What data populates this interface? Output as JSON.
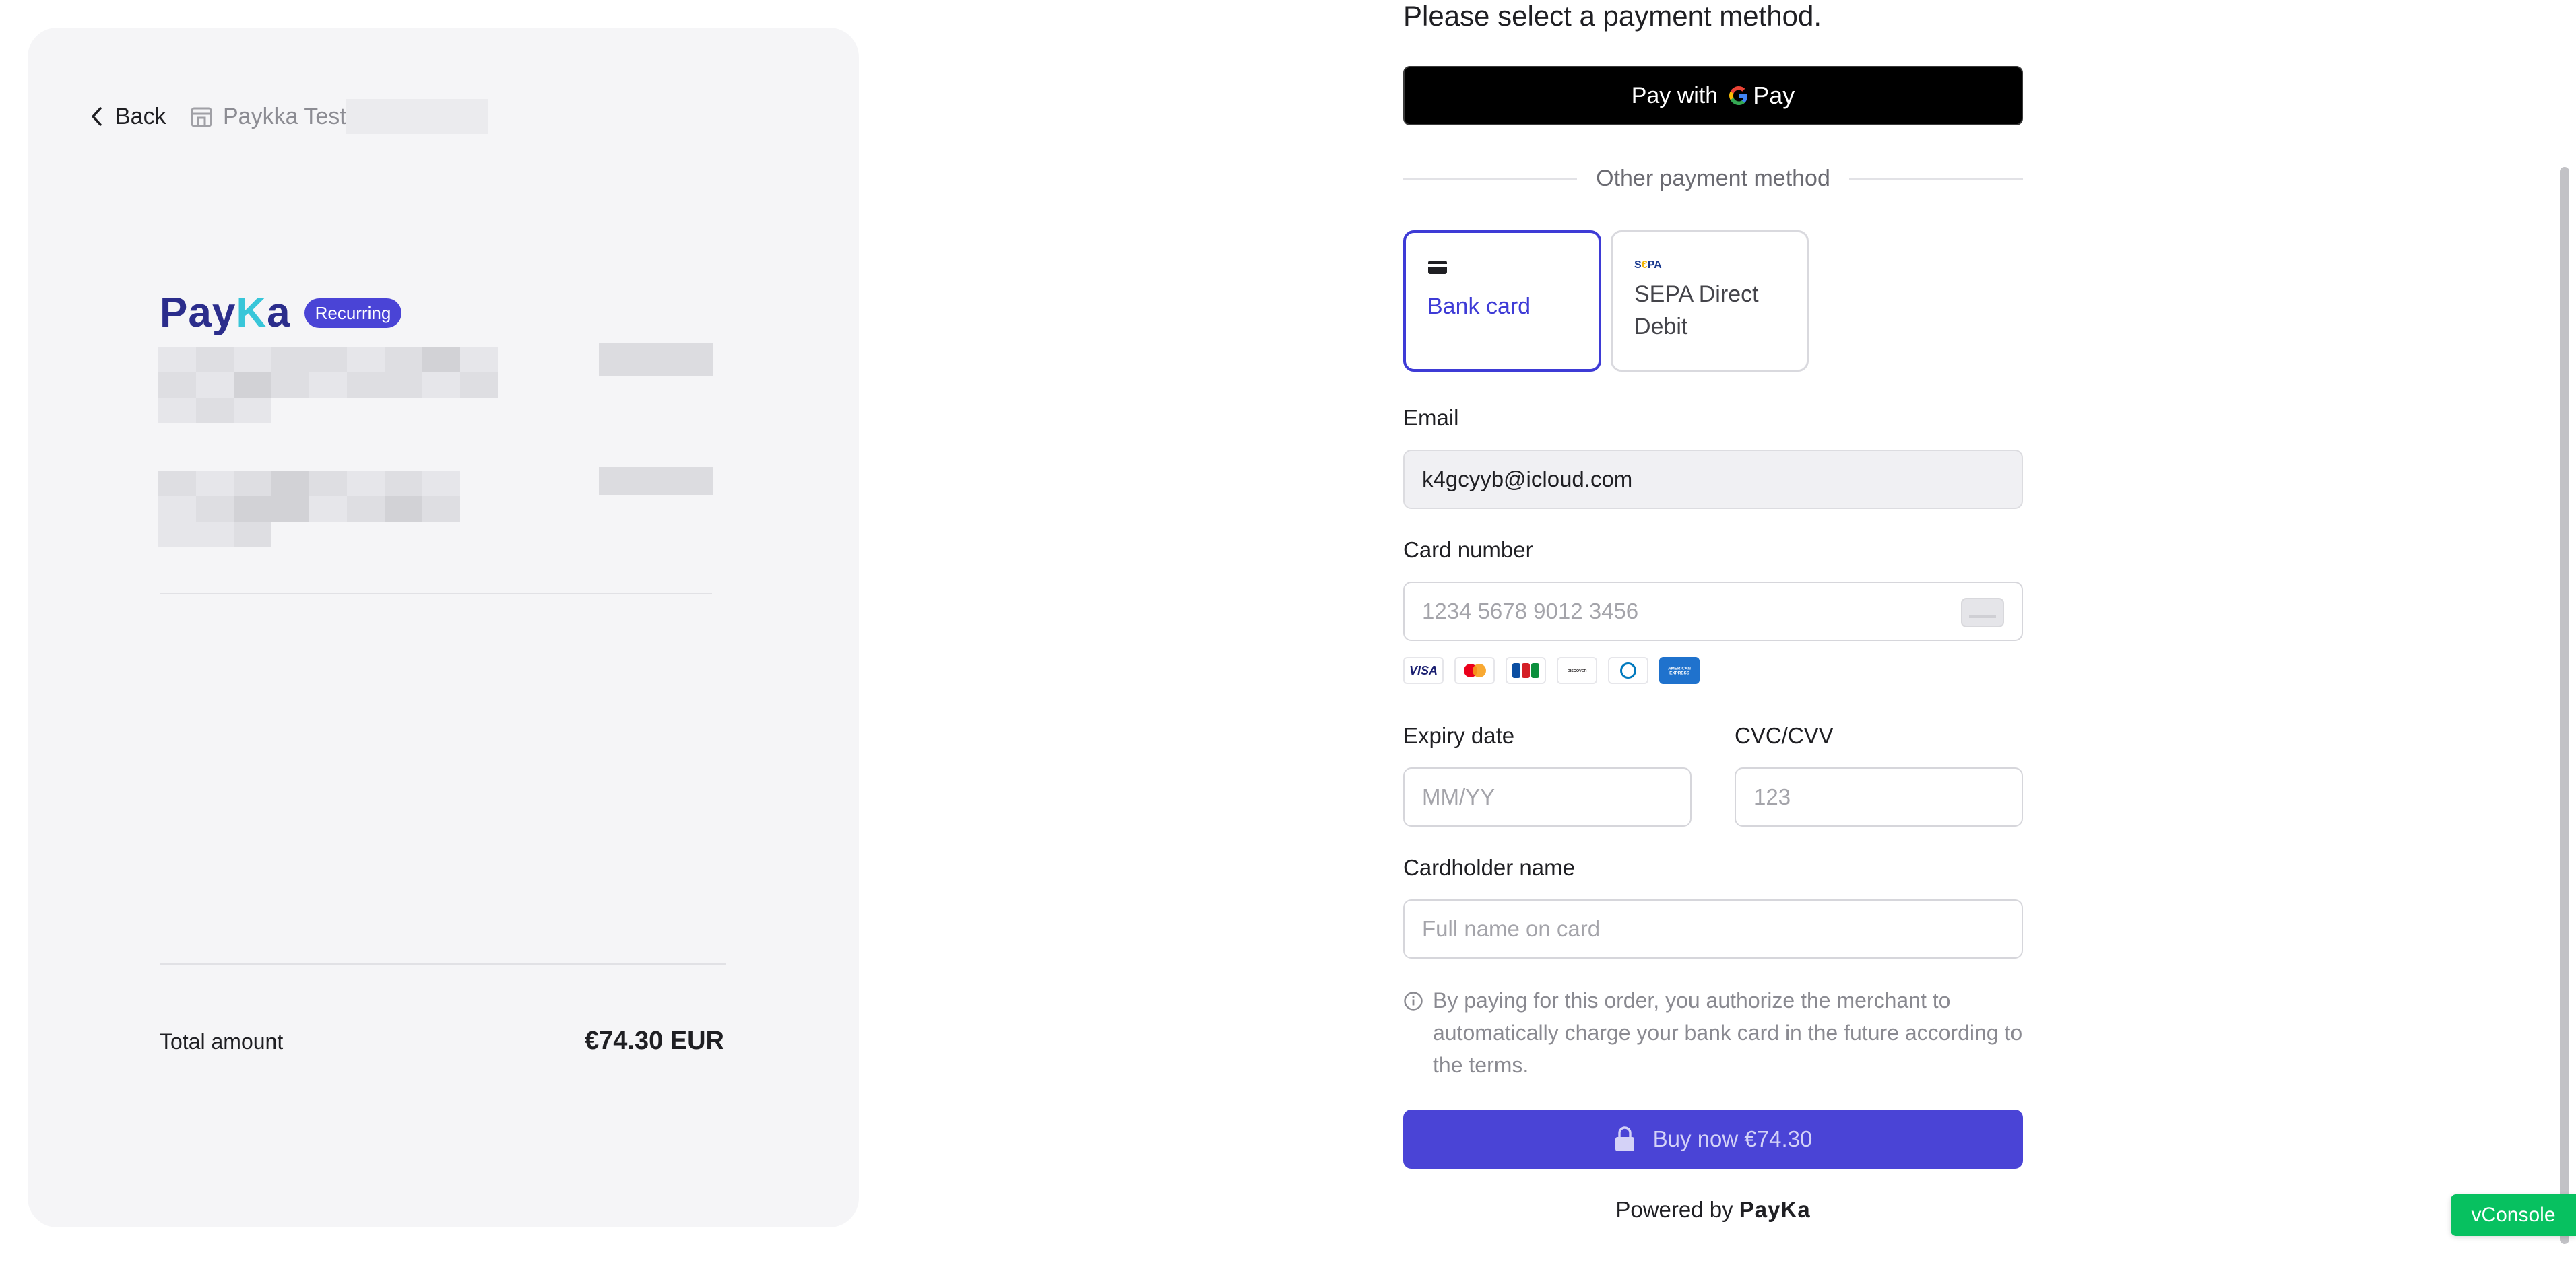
{
  "left": {
    "back_label": "Back",
    "merchant_name": "Paykka Test",
    "logo": {
      "part1": "Pay",
      "part2": "K",
      "part3": "a"
    },
    "badge": "Recurring",
    "total_label": "Total amount",
    "total_value": "€74.30 EUR"
  },
  "form": {
    "heading": "Please select a payment method.",
    "gpay": {
      "prefix": "Pay with",
      "g": "G",
      "pay": "Pay"
    },
    "other_methods": "Other payment method",
    "methods": [
      {
        "label": "Bank card"
      },
      {
        "label": "SEPA Direct Debit",
        "icon_text_a": "S",
        "icon_text_b": "€",
        "icon_text_c": "PA"
      }
    ],
    "email": {
      "label": "Email",
      "value": "k4gcyyb@icloud.com"
    },
    "card_number": {
      "label": "Card number",
      "placeholder": "1234 5678 9012 3456"
    },
    "brands": [
      "VISA",
      "JCB",
      "DISCOVER",
      "AMERICAN EXPRESS"
    ],
    "expiry": {
      "label": "Expiry date",
      "placeholder": "MM/YY"
    },
    "cvc": {
      "label": "CVC/CVV",
      "placeholder": "123"
    },
    "cardholder": {
      "label": "Cardholder name",
      "placeholder": "Full name on card"
    },
    "notice": "By paying for this order, you authorize the merchant to automatically charge your bank card in the future according to the terms.",
    "buy_label": "Buy now €74.30",
    "powered_prefix": "Powered by",
    "powered_brand": "PayKa"
  },
  "vconsole_label": "vConsole",
  "colors": {
    "accent": "#4a44d6",
    "panel_bg": "#f5f5f7",
    "vconsole": "#07c160"
  }
}
